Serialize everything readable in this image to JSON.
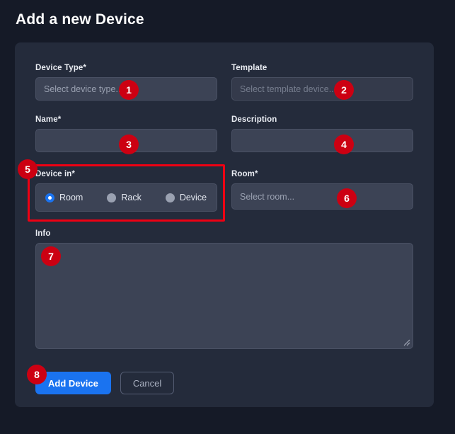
{
  "page": {
    "title": "Add a new Device",
    "background": "#151a27",
    "card_background": "#242b3b",
    "accent_blue": "#1a73f0",
    "annotation_red": "#cc0012",
    "highlight_red": "#ee0013"
  },
  "fields": {
    "device_type": {
      "label": "Device Type*",
      "placeholder": "Select device type...",
      "value": "",
      "type": "select",
      "disabled": false
    },
    "template": {
      "label": "Template",
      "placeholder": "Select template device...",
      "value": "",
      "type": "select",
      "disabled": true
    },
    "name": {
      "label": "Name*",
      "placeholder": "",
      "value": "",
      "type": "text"
    },
    "description": {
      "label": "Description",
      "placeholder": "",
      "value": "",
      "type": "text"
    },
    "device_in": {
      "label": "Device in*",
      "type": "radio-group",
      "selected": "Room",
      "options": [
        {
          "label": "Room",
          "selected": true
        },
        {
          "label": "Rack",
          "selected": false
        },
        {
          "label": "Device",
          "selected": false
        }
      ]
    },
    "room": {
      "label": "Room*",
      "placeholder": "Select room...",
      "value": "",
      "type": "select",
      "disabled": false
    },
    "info": {
      "label": "Info",
      "placeholder": "",
      "value": "",
      "type": "textarea"
    }
  },
  "actions": {
    "submit_label": "Add Device",
    "cancel_label": "Cancel"
  },
  "annotations": {
    "badges": [
      {
        "number": "1",
        "target": "device-type-select"
      },
      {
        "number": "2",
        "target": "template-select"
      },
      {
        "number": "3",
        "target": "name-input"
      },
      {
        "number": "4",
        "target": "description-input"
      },
      {
        "number": "5",
        "target": "device-in-radio-group"
      },
      {
        "number": "6",
        "target": "room-select"
      },
      {
        "number": "7",
        "target": "info-textarea"
      },
      {
        "number": "8",
        "target": "submit-button"
      }
    ]
  }
}
